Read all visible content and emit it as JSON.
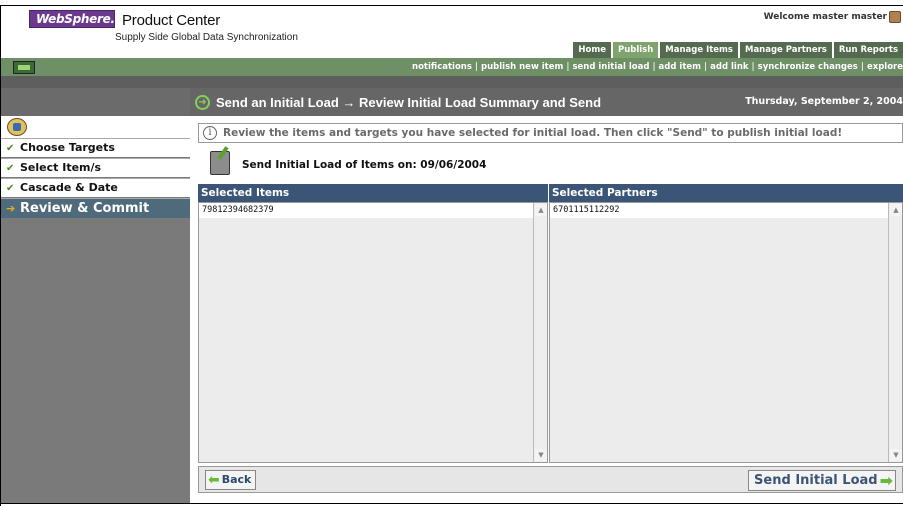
{
  "header": {
    "brand": "WebSphere.",
    "product": "Product Center",
    "subtitle": "Supply Side Global Data Synchronization",
    "welcome": "Welcome   master master"
  },
  "tabs": [
    {
      "label": "Home",
      "active": false
    },
    {
      "label": "Publish",
      "active": true
    },
    {
      "label": "Manage Items",
      "active": false
    },
    {
      "label": "Manage Partners",
      "active": false
    },
    {
      "label": "Run Reports",
      "active": false
    }
  ],
  "subnav": {
    "links": [
      "notifications",
      "publish new item",
      "send initial load",
      "add item",
      "add link",
      "synchronize changes",
      "explore"
    ]
  },
  "sidebar": {
    "steps": [
      {
        "label": "Choose Targets",
        "done": true
      },
      {
        "label": "Select Item/s",
        "done": true
      },
      {
        "label": "Cascade & Date",
        "done": true
      },
      {
        "label": "Review & Commit",
        "done": false,
        "active": true
      }
    ]
  },
  "main": {
    "title": "Send an Initial Load →  Review Initial Load  Summary and Send",
    "date": "Thursday, September 2, 2004",
    "info": "Review the items and targets you have selected for initial load. Then click \"Send\" to publish initial load!",
    "load_text": "Send Initial Load of Items on: 09/06/2004",
    "items_header": "Selected Items",
    "partners_header": "Selected Partners",
    "items": [
      "79812394682379"
    ],
    "partners": [
      "6701115112292"
    ],
    "back_label": "Back",
    "send_label": "Send Initial Load"
  },
  "colors": {
    "header_blue": "#3b5577",
    "nav_green": "#6f8f66",
    "active_tab": "#7ea36c",
    "brand_purple": "#6b3a8f"
  }
}
